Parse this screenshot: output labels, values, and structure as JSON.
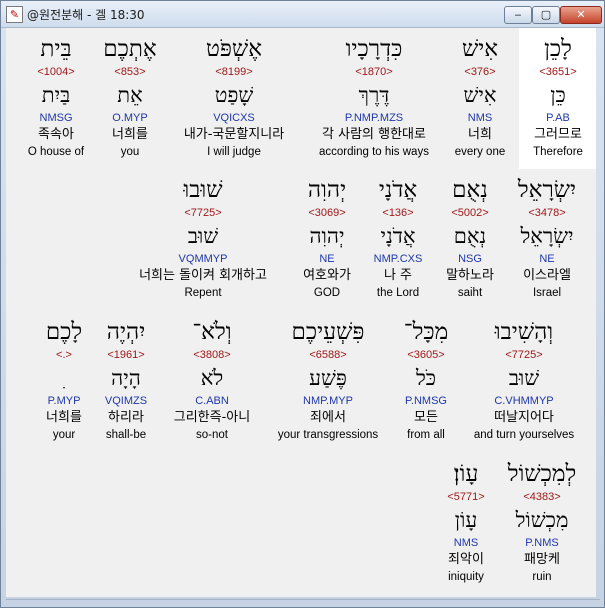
{
  "window": {
    "title": "@원전분해 - 겔 18:30",
    "minimize_label": "‒",
    "maximize_label": "▢",
    "close_label": "✕"
  },
  "words": [
    {
      "hebrew": "לָכֵן",
      "strong": "<3651>",
      "lemma": "כֵּן",
      "morph": "P.AB",
      "korean": "그러므로",
      "english": "Therefore"
    },
    {
      "hebrew": "אִישׁ",
      "strong": "<376>",
      "lemma": "אִישׁ",
      "morph": "NMS",
      "korean": "너희",
      "english": "every one"
    },
    {
      "hebrew": "כִּדְרָכָיו",
      "strong": "<1870>",
      "lemma": "דֶּרֶךְ",
      "morph": "P.NMP.MZS",
      "korean": "각 사람의 행한대로",
      "english": "according to his ways"
    },
    {
      "hebrew": "אֶשְׁפֹּט",
      "strong": "<8199>",
      "lemma": "שָׁפַט",
      "morph": "VQICXS",
      "korean": "내가-국문할지니라",
      "english": "I will judge"
    },
    {
      "hebrew": "אֶתְכֶם",
      "strong": "<853>",
      "lemma": "אֵת",
      "morph": "O.MYP",
      "korean": "너희를",
      "english": "you"
    },
    {
      "hebrew": "בֵּית",
      "strong": "<1004>",
      "lemma": "בַּיִת",
      "morph": "NMSG",
      "korean": "족속아",
      "english": "O house of"
    },
    {
      "hebrew": "יִשְׂרָאֵל",
      "strong": "<3478>",
      "lemma": "יִשְׂרָאֵל",
      "morph": "NE",
      "korean": "이스라엘",
      "english": "Israel"
    },
    {
      "hebrew": "נְאֻם",
      "strong": "<5002>",
      "lemma": "נְאֻם",
      "morph": "NSG",
      "korean": "말하노라",
      "english": "saiht"
    },
    {
      "hebrew": "אֲדֹנָי",
      "strong": "<136>",
      "lemma": "אֲדֹנָי",
      "morph": "NMP.CXS",
      "korean": "나 주",
      "english": "the Lord"
    },
    {
      "hebrew": "יְהוִה",
      "strong": "<3069>",
      "lemma": "יְהוִה",
      "morph": "NE",
      "korean": "여호와가",
      "english": "GOD"
    },
    {
      "hebrew": "שׁוּבוּ",
      "strong": "<7725>",
      "lemma": "שׁוּב",
      "morph": "VQMMYP",
      "korean": "너희는 돌이켜 회개하고",
      "english": "Repent"
    },
    {
      "hebrew": "וְהָשִׁיבוּ",
      "strong": "<7725>",
      "lemma": "שׁוּב",
      "morph": "C.VHMMYP",
      "korean": "떠날지어다",
      "english": "and turn yourselves"
    },
    {
      "hebrew": "מִכָּל־",
      "strong": "<3605>",
      "lemma": "כֹּל",
      "morph": "P.NMSG",
      "korean": "모든",
      "english": "from all"
    },
    {
      "hebrew": "פִּשְׁעֵיכֶם",
      "strong": "<6588>",
      "lemma": "פֶּשַׁע",
      "morph": "NMP.MYP",
      "korean": "죄에서",
      "english": "your transgressions"
    },
    {
      "hebrew": "וְלֹא־",
      "strong": "<3808>",
      "lemma": "לֹא",
      "morph": "C.ABN",
      "korean": "그리한즉-아니",
      "english": "so-not"
    },
    {
      "hebrew": "יִהְיֶה",
      "strong": "<1961>",
      "lemma": "הָיָה",
      "morph": "VQIMZS",
      "korean": "하리라",
      "english": "shall-be"
    },
    {
      "hebrew": "לָכֶם",
      "strong": "<.>",
      "lemma": "ִ",
      "morph": "P.MYP",
      "korean": "너희를",
      "english": "your"
    },
    {
      "hebrew": "לְמִכְשׁוֹל",
      "strong": "<4383>",
      "lemma": "מִכְשׁוֹל",
      "morph": "P.NMS",
      "korean": "패망케",
      "english": "ruin"
    },
    {
      "hebrew": "עָוֹן׃",
      "strong": "<5771>",
      "lemma": "עָוֹן",
      "morph": "NMS",
      "korean": "죄악이",
      "english": "iniquity"
    }
  ]
}
